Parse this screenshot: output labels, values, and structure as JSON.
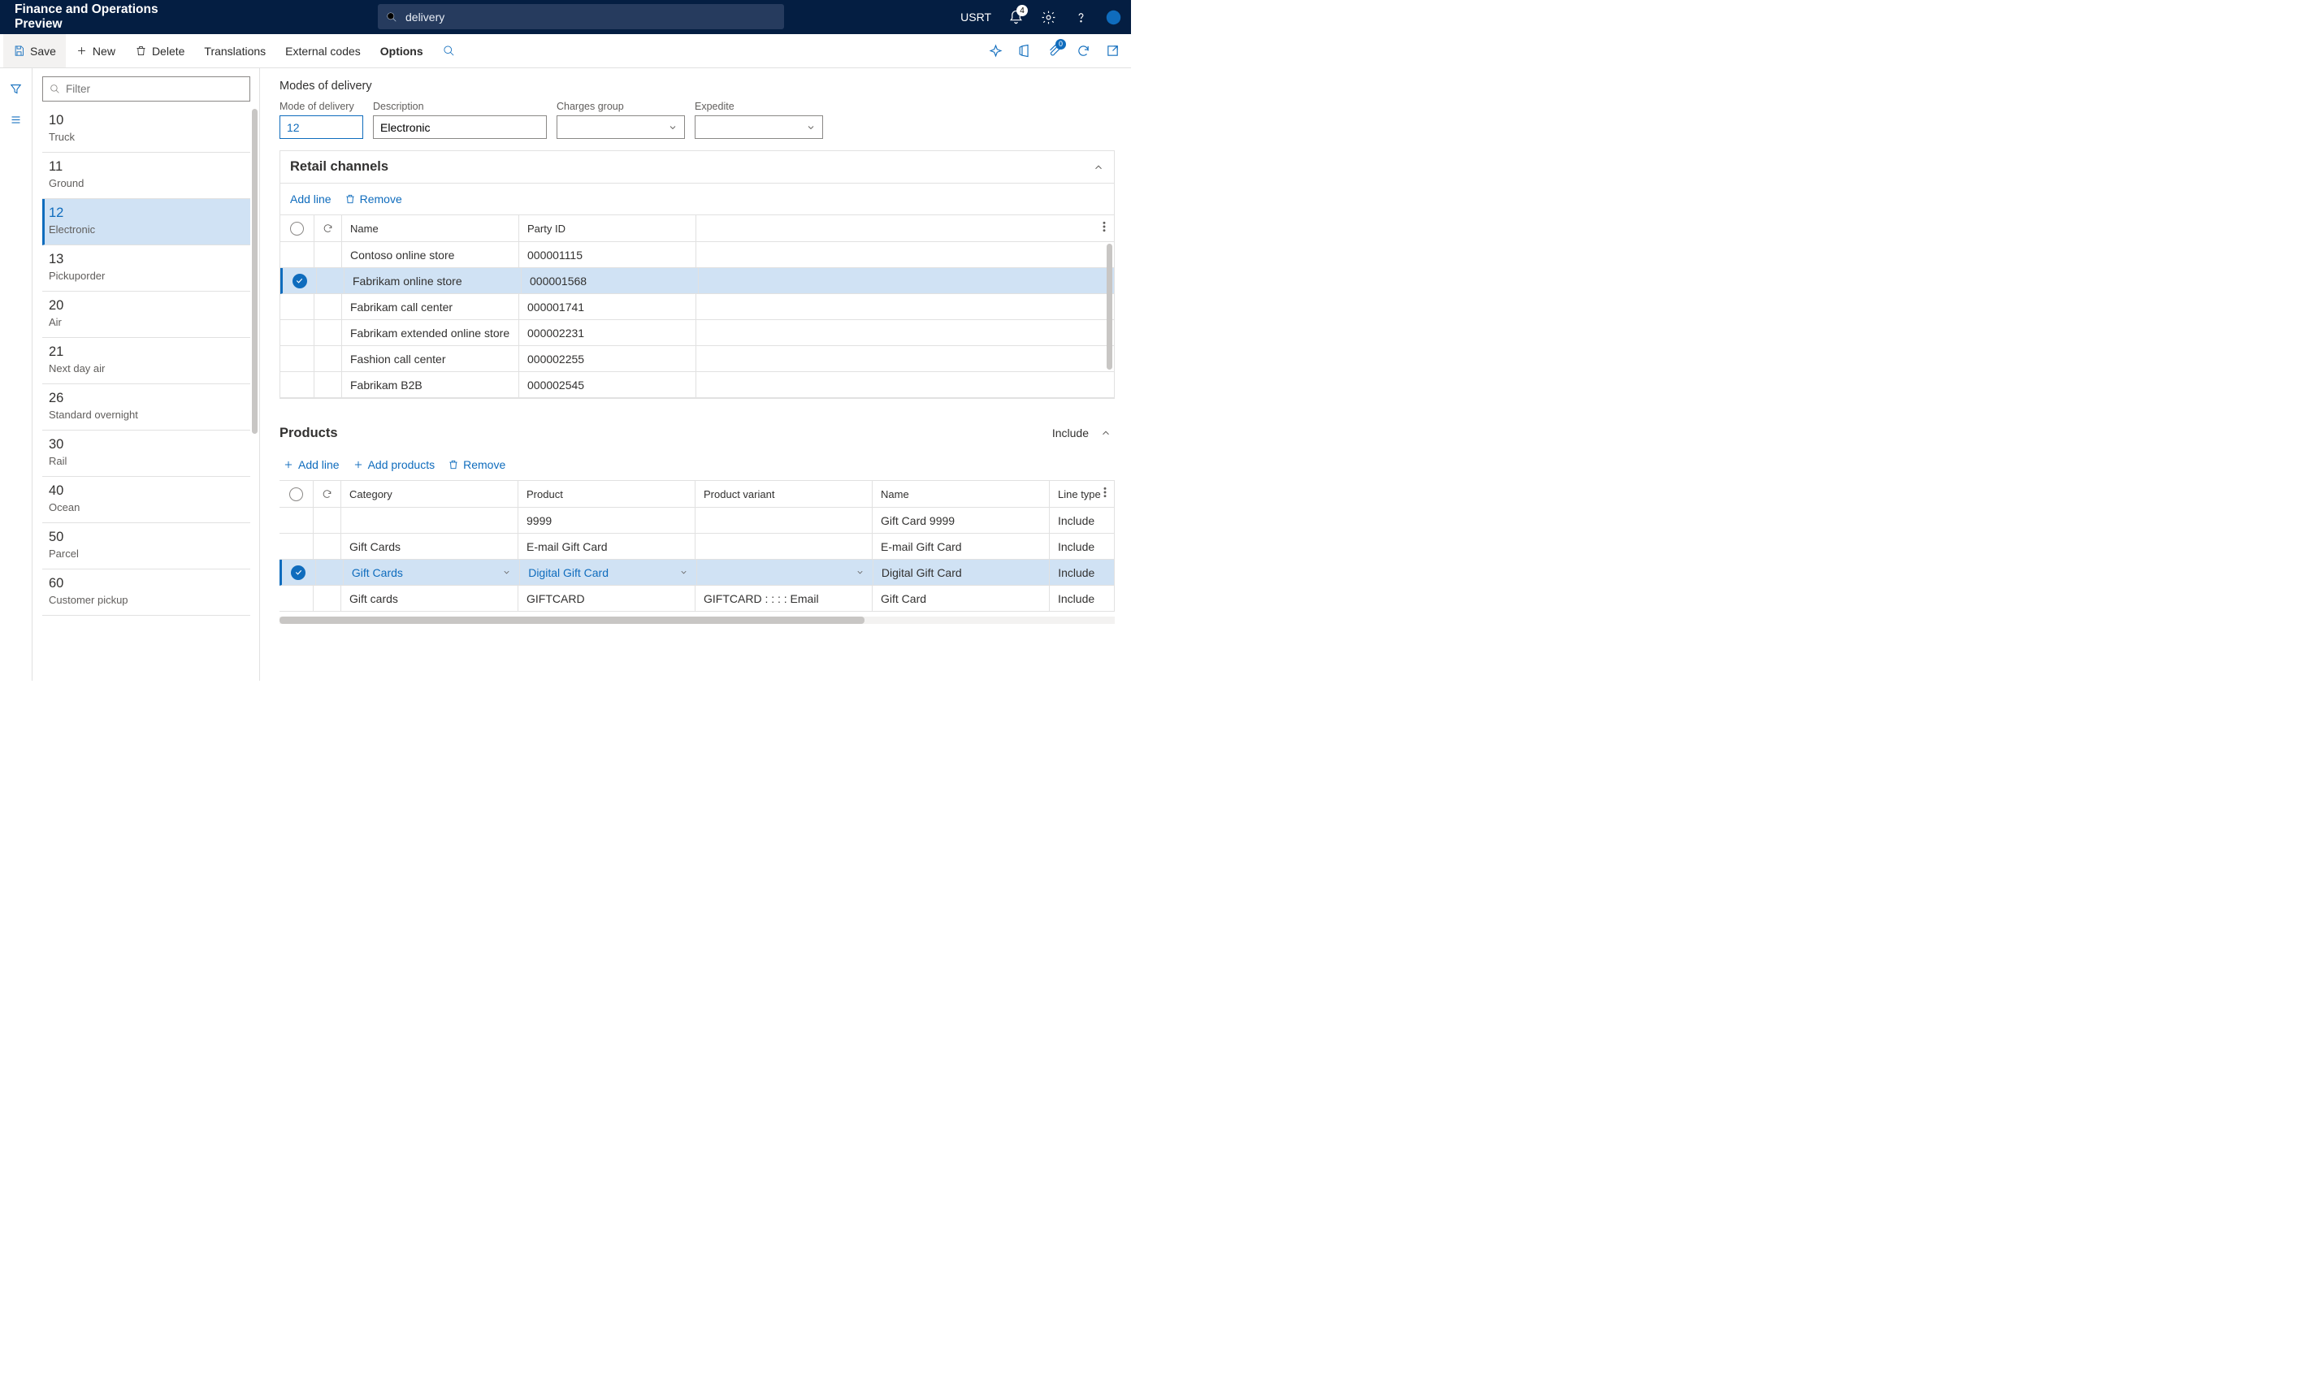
{
  "topbar": {
    "title": "Finance and Operations Preview",
    "search_value": "delivery",
    "company": "USRT",
    "bell_badge": "4"
  },
  "actionbar": {
    "save": "Save",
    "new": "New",
    "delete": "Delete",
    "translations": "Translations",
    "external_codes": "External codes",
    "options": "Options",
    "attach_badge": "0"
  },
  "listpane": {
    "filter_placeholder": "Filter",
    "items": [
      {
        "code": "10",
        "desc": "Truck"
      },
      {
        "code": "11",
        "desc": "Ground"
      },
      {
        "code": "12",
        "desc": "Electronic"
      },
      {
        "code": "13",
        "desc": "Pickuporder"
      },
      {
        "code": "20",
        "desc": "Air"
      },
      {
        "code": "21",
        "desc": "Next day air"
      },
      {
        "code": "26",
        "desc": "Standard overnight"
      },
      {
        "code": "30",
        "desc": "Rail"
      },
      {
        "code": "40",
        "desc": "Ocean"
      },
      {
        "code": "50",
        "desc": "Parcel"
      },
      {
        "code": "60",
        "desc": "Customer pickup"
      }
    ],
    "selected_index": 2
  },
  "detail": {
    "page_title": "Modes of delivery",
    "fields": {
      "mode_label": "Mode of delivery",
      "mode_value": "12",
      "description_label": "Description",
      "description_value": "Electronic",
      "charges_label": "Charges group",
      "charges_value": "",
      "expedite_label": "Expedite",
      "expedite_value": ""
    },
    "retail": {
      "title": "Retail channels",
      "add_line": "Add line",
      "remove": "Remove",
      "col_name": "Name",
      "col_party": "Party ID",
      "rows": [
        {
          "name": "Contoso online store",
          "party": "000001115"
        },
        {
          "name": "Fabrikam online store",
          "party": "000001568"
        },
        {
          "name": "Fabrikam call center",
          "party": "000001741"
        },
        {
          "name": "Fabrikam extended online store",
          "party": "000002231"
        },
        {
          "name": "Fashion call center",
          "party": "000002255"
        },
        {
          "name": "Fabrikam B2B",
          "party": "000002545"
        }
      ],
      "selected_index": 1
    },
    "products": {
      "title": "Products",
      "include_label": "Include",
      "add_line": "Add line",
      "add_products": "Add products",
      "remove": "Remove",
      "col_category": "Category",
      "col_product": "Product",
      "col_variant": "Product variant",
      "col_name": "Name",
      "col_linetype": "Line type",
      "rows": [
        {
          "category": "",
          "product": "9999",
          "variant": "",
          "name": "Gift Card 9999",
          "linetype": "Include"
        },
        {
          "category": "Gift Cards",
          "product": "E-mail Gift Card",
          "variant": "",
          "name": "E-mail Gift Card",
          "linetype": "Include"
        },
        {
          "category": "Gift Cards",
          "product": "Digital Gift Card",
          "variant": "",
          "name": "Digital Gift Card",
          "linetype": "Include"
        },
        {
          "category": "Gift cards",
          "product": "GIFTCARD",
          "variant": "GIFTCARD :  :  :  : Email",
          "name": "Gift Card",
          "linetype": "Include"
        }
      ],
      "selected_index": 2
    }
  }
}
